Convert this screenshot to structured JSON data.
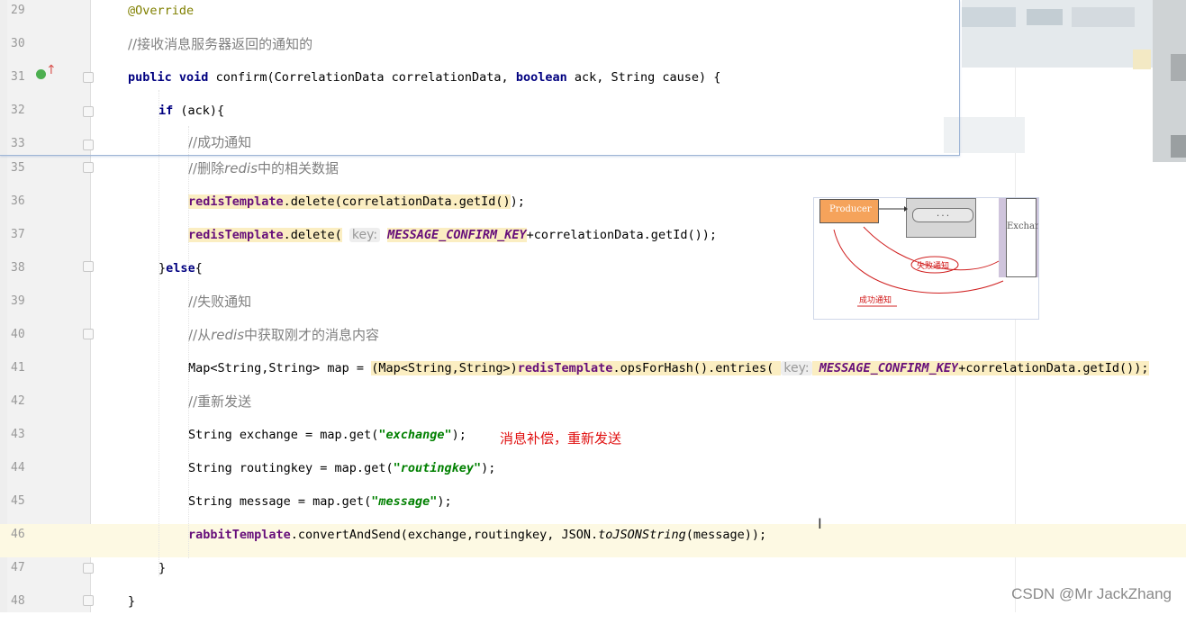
{
  "lines": [
    {
      "num": "29",
      "tokens": [
        {
          "t": "@Override",
          "c": "ann"
        }
      ],
      "indent": 0
    },
    {
      "num": "30",
      "tokens": [
        {
          "t": "//接收消息服务器返回的通知的",
          "c": "cmt"
        }
      ],
      "indent": 0
    },
    {
      "num": "31",
      "tokens": [
        {
          "t": "public",
          "c": "kw"
        },
        {
          "t": " "
        },
        {
          "t": "void",
          "c": "kw"
        },
        {
          "t": " confirm(CorrelationData correlationData, "
        },
        {
          "t": "boolean",
          "c": "kw"
        },
        {
          "t": " ack, String cause) {"
        }
      ],
      "indent": 0
    },
    {
      "num": "32",
      "tokens": [
        {
          "t": "if",
          "c": "kw"
        },
        {
          "t": " (ack){"
        }
      ],
      "indent": 1
    },
    {
      "num": "33",
      "tokens": [
        {
          "t": "//成功通知",
          "c": "cmt"
        }
      ],
      "indent": 2
    },
    {
      "num": "35",
      "tokens": [
        {
          "t": "//删除",
          "c": "cmt"
        },
        {
          "t": "redis",
          "c": "cmt ital"
        },
        {
          "t": "中的相关数据",
          "c": "cmt"
        }
      ],
      "indent": 2
    },
    {
      "num": "36",
      "tokens": [
        {
          "t": "redisTemplate",
          "c": "fld hl"
        },
        {
          "t": ".delete(",
          "c": "hl"
        },
        {
          "t": "correlationData.getId()",
          "c": "hl"
        },
        {
          "t": ");"
        }
      ],
      "indent": 2
    },
    {
      "num": "37",
      "tokens": [
        {
          "t": "redisTemplate",
          "c": "fld hl"
        },
        {
          "t": ".delete(",
          "c": "hl"
        },
        {
          "t": " "
        },
        {
          "t": "key:",
          "c": "hint"
        },
        {
          "t": " "
        },
        {
          "t": "MESSAGE_CONFIRM_KEY",
          "c": "stat hl"
        },
        {
          "t": "+correlationData.getId());"
        }
      ],
      "indent": 2
    },
    {
      "num": "38",
      "tokens": [
        {
          "t": "}"
        },
        {
          "t": "else",
          "c": "kw"
        },
        {
          "t": "{"
        }
      ],
      "indent": 1
    },
    {
      "num": "39",
      "tokens": [
        {
          "t": "//失败通知",
          "c": "cmt"
        }
      ],
      "indent": 2
    },
    {
      "num": "40",
      "tokens": [
        {
          "t": "//从",
          "c": "cmt"
        },
        {
          "t": "redis",
          "c": "cmt ital"
        },
        {
          "t": "中获取刚才的消息内容",
          "c": "cmt"
        }
      ],
      "indent": 2
    },
    {
      "num": "41",
      "tokens": [
        {
          "t": "Map<String,String> map = "
        },
        {
          "t": "(Map<String,String>)",
          "c": "hl"
        },
        {
          "t": "redisTemplate",
          "c": "fld hl"
        },
        {
          "t": ".opsForHash().entries(",
          "c": "hl"
        },
        {
          "t": " ",
          "c": "hl"
        },
        {
          "t": "key:",
          "c": "hint"
        },
        {
          "t": " ",
          "c": "hl"
        },
        {
          "t": "MESSAGE_CONFIRM_KEY",
          "c": "stat hl"
        },
        {
          "t": "+correlationData.getId());",
          "c": "hl"
        }
      ],
      "indent": 2
    },
    {
      "num": "42",
      "tokens": [
        {
          "t": "//重新发送",
          "c": "cmt"
        }
      ],
      "indent": 2
    },
    {
      "num": "43",
      "tokens": [
        {
          "t": "String exchange = map.get("
        },
        {
          "t": "\"exchange\"",
          "c": "str"
        },
        {
          "t": ");"
        }
      ],
      "indent": 2
    },
    {
      "num": "44",
      "tokens": [
        {
          "t": "String routingkey = map.get("
        },
        {
          "t": "\"routingkey\"",
          "c": "str"
        },
        {
          "t": ");"
        }
      ],
      "indent": 2
    },
    {
      "num": "45",
      "tokens": [
        {
          "t": "String message = map.get("
        },
        {
          "t": "\"message\"",
          "c": "str"
        },
        {
          "t": ");"
        }
      ],
      "indent": 2
    },
    {
      "num": "46",
      "tokens": [
        {
          "t": "rabbitTemplate",
          "c": "fld"
        },
        {
          "t": ".convertAndSend(exchange,routingkey, JSON."
        },
        {
          "t": "toJSONString",
          "c": "ital"
        },
        {
          "t": "(message));"
        }
      ],
      "indent": 2,
      "current": true
    },
    {
      "num": "47",
      "tokens": [
        {
          "t": "}"
        }
      ],
      "indent": 1
    },
    {
      "num": "48",
      "tokens": [
        {
          "t": "}"
        }
      ],
      "indent": 0
    }
  ],
  "annotation_red": "消息补偿，重新发送",
  "watermark": "CSDN @Mr JackZhang",
  "diagram": {
    "producer": "Producer",
    "queue_dots": "...",
    "exchange": "Exchan",
    "fail_label": "失败通知",
    "success_label": "成功通知"
  },
  "colors": {
    "keyword": "#000080",
    "comment": "#808080",
    "annotation": "#808000",
    "field": "#660e7a",
    "string": "#008000",
    "highlight": "#fbeec2",
    "current_line": "#fdf9e3",
    "red_note": "#e01010"
  }
}
